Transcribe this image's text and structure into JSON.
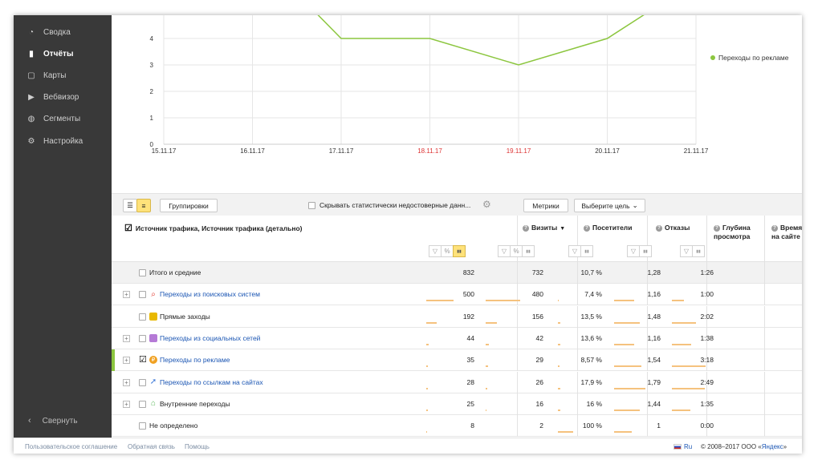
{
  "sidebar": {
    "items": [
      {
        "label": "Сводка",
        "icon": "dashboard-icon",
        "active": false
      },
      {
        "label": "Отчёты",
        "icon": "bar-chart-icon",
        "active": true
      },
      {
        "label": "Карты",
        "icon": "map-icon",
        "active": false
      },
      {
        "label": "Вебвизор",
        "icon": "play-icon",
        "active": false
      },
      {
        "label": "Сегменты",
        "icon": "segment-icon",
        "active": false
      },
      {
        "label": "Настройка",
        "icon": "gear-icon",
        "active": false
      }
    ],
    "collapse_label": "Свернуть"
  },
  "chart_data": {
    "type": "line",
    "x": [
      "15.11.17",
      "16.11.17",
      "17.11.17",
      "18.11.17",
      "19.11.17",
      "20.11.17",
      "21.11.17"
    ],
    "weekend_ticks": [
      "18.11.17",
      "19.11.17"
    ],
    "y_ticks": [
      "0",
      "1",
      "2",
      "3",
      "4"
    ],
    "ylim": [
      0,
      5
    ],
    "series": [
      {
        "name": "Переходы по рекламе",
        "color": "#8cc63f",
        "values": [
          null,
          null,
          4,
          4,
          3,
          4,
          null
        ]
      }
    ],
    "note": "line enters from above plot top before 17.11.17 and exits above after 20.11.17",
    "legend": "right",
    "grid": true
  },
  "toolbar": {
    "groupings_label": "Группировки",
    "hide_unreliable_label": "Скрывать статистически недостоверные данн...",
    "metrics_label": "Метрики",
    "goal_label": "Выберите цель"
  },
  "table": {
    "dimension_header": "Источник трафика, Источник трафика (детально)",
    "columns": [
      {
        "label": "Визиты",
        "sort": "▼"
      },
      {
        "label": "Посетители"
      },
      {
        "label": "Отказы"
      },
      {
        "label": "Глубина просмотра"
      },
      {
        "label": "Время на сайте"
      }
    ],
    "total": {
      "label": "Итого и средние",
      "values": [
        "832",
        "732",
        "10,7 %",
        "1,28",
        "1:26"
      ]
    },
    "rows": [
      {
        "label": "Переходы из поисковых систем",
        "link": true,
        "expandable": true,
        "checked": false,
        "icon": "search-icon",
        "icon_color": "#e03a2f",
        "values": [
          "500",
          "480",
          "7,4 %",
          "1,16",
          "1:00"
        ],
        "shares": [
          0.601,
          0.656,
          0.069,
          0.906,
          0.698
        ]
      },
      {
        "label": "Прямые заходы",
        "link": false,
        "expandable": false,
        "checked": false,
        "icon": "direct-icon",
        "icon_color": "#e8b800",
        "values": [
          "192",
          "156",
          "13,5 %",
          "1,48",
          "2:02"
        ],
        "shares": [
          0.231,
          0.213,
          0.126,
          1.156,
          1.419
        ]
      },
      {
        "label": "Переходы из социальных сетей",
        "link": true,
        "expandable": true,
        "checked": false,
        "icon": "social-icon",
        "icon_color": "#b57ad6",
        "values": [
          "44",
          "42",
          "13,6 %",
          "1,16",
          "1:38"
        ],
        "shares": [
          0.053,
          0.057,
          0.127,
          0.906,
          1.14
        ]
      },
      {
        "label": "Переходы по рекламе",
        "link": true,
        "expandable": true,
        "checked": true,
        "icon": "ad-icon",
        "icon_color": "#f0a020",
        "selected": true,
        "values": [
          "35",
          "29",
          "8,57 %",
          "1,54",
          "3:18"
        ],
        "shares": [
          0.042,
          0.04,
          0.08,
          1.203,
          2.302
        ]
      },
      {
        "label": "Переходы по ссылкам на сайтах",
        "link": true,
        "expandable": true,
        "checked": false,
        "icon": "link-icon",
        "icon_color": "#3b78d8",
        "values": [
          "28",
          "26",
          "17,9 %",
          "1,79",
          "2:49"
        ],
        "shares": [
          0.034,
          0.036,
          0.167,
          1.398,
          1.965
        ]
      },
      {
        "label": "Внутренние переходы",
        "link": false,
        "expandable": true,
        "checked": false,
        "icon": "home-icon",
        "icon_color": "#5cb85c",
        "values": [
          "25",
          "16",
          "16 %",
          "1,44",
          "1:35"
        ],
        "shares": [
          0.03,
          0.022,
          0.15,
          1.125,
          1.105
        ]
      },
      {
        "label": "Не определено",
        "link": false,
        "expandable": false,
        "checked": false,
        "icon": null,
        "icon_color": null,
        "values": [
          "8",
          "2",
          "100 %",
          "1",
          "0:00"
        ],
        "shares": [
          0.01,
          0.003,
          0.935,
          0.781,
          0
        ]
      }
    ]
  },
  "footer": {
    "agreement": "Пользовательское соглашение",
    "feedback": "Обратная связь",
    "help": "Помощь",
    "lang": "Ru",
    "copyright_prefix": "© 2008–2017  ООО «",
    "company_link": "Яндекс",
    "copyright_suffix": "»"
  }
}
